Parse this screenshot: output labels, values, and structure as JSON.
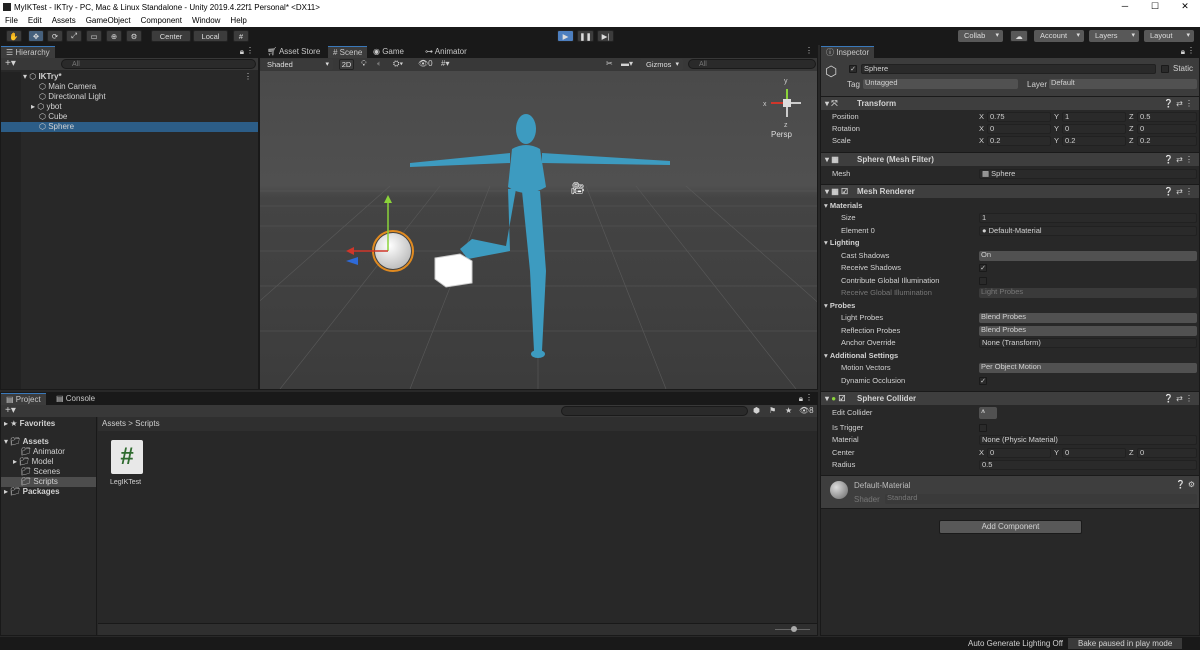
{
  "window": {
    "title": "MyIKTest - IKTry - PC, Mac & Linux Standalone - Unity 2019.4.22f1 Personal* <DX11>",
    "minimize": "─",
    "maximize": "☐",
    "close": "✕"
  },
  "menu": [
    "File",
    "Edit",
    "Assets",
    "GameObject",
    "Component",
    "Window",
    "Help"
  ],
  "toolbar": {
    "center": "Center",
    "local": "Local",
    "collab": "Collab",
    "account": "Account",
    "layers": "Layers",
    "layout": "Layout"
  },
  "hierarchy": {
    "tab": "Hierarchy",
    "search": "All",
    "scene": "IKTry*",
    "items": [
      "Main Camera",
      "Directional Light",
      "ybot",
      "Cube",
      "Sphere"
    ]
  },
  "sceneView": {
    "tabs": [
      "Asset Store",
      "Scene",
      "Game",
      "Animator"
    ],
    "shading": "Shaded",
    "mode2d": "2D",
    "gizmos": "Gizmos",
    "search": "All",
    "hidden": "0",
    "persp": "Persp",
    "axisX": "x",
    "axisY": "y",
    "axisZ": "z"
  },
  "project": {
    "tabs": [
      "Project",
      "Console"
    ],
    "favorites": "Favorites",
    "assets": "Assets",
    "folders": [
      "Animator",
      "Model",
      "Scenes",
      "Scripts"
    ],
    "packages": "Packages",
    "breadcrumb": [
      "Assets",
      "Scripts"
    ],
    "file": "LegIKTest",
    "fileIcon": "#",
    "count": "8"
  },
  "status": {
    "lighting": "Auto Generate Lighting Off",
    "bake": "Bake paused in play mode"
  },
  "inspector": {
    "tab": "Inspector",
    "name": "Sphere",
    "static": "Static",
    "tagLabel": "Tag",
    "tag": "Untagged",
    "layerLabel": "Layer",
    "layer": "Default",
    "transform": {
      "title": "Transform",
      "rows": [
        {
          "label": "Position",
          "x": "0.75",
          "y": "1",
          "z": "0.5"
        },
        {
          "label": "Rotation",
          "x": "0",
          "y": "0",
          "z": "0"
        },
        {
          "label": "Scale",
          "x": "0.2",
          "y": "0.2",
          "z": "0.2"
        }
      ]
    },
    "meshFilter": {
      "title": "Sphere (Mesh Filter)",
      "meshLabel": "Mesh",
      "mesh": "Sphere"
    },
    "meshRenderer": {
      "title": "Mesh Renderer",
      "materials": "Materials",
      "sizeLabel": "Size",
      "size": "1",
      "elementLabel": "Element 0",
      "element": "Default-Material",
      "lighting": "Lighting",
      "castLabel": "Cast Shadows",
      "cast": "On",
      "receiveLabel": "Receive Shadows",
      "contribLabel": "Contribute Global Illumination",
      "receiveGILabel": "Receive Global Illumination",
      "receiveGI": "Light Probes",
      "probes": "Probes",
      "lightProbesLabel": "Light Probes",
      "lightProbes": "Blend Probes",
      "reflLabel": "Reflection Probes",
      "refl": "Blend Probes",
      "anchorLabel": "Anchor Override",
      "anchor": "None (Transform)",
      "additional": "Additional Settings",
      "motionLabel": "Motion Vectors",
      "motion": "Per Object Motion",
      "dynLabel": "Dynamic Occlusion"
    },
    "collider": {
      "title": "Sphere Collider",
      "editLabel": "Edit Collider",
      "triggerLabel": "Is Trigger",
      "materialLabel": "Material",
      "material": "None (Physic Material)",
      "centerLabel": "Center",
      "cx": "0",
      "cy": "0",
      "cz": "0",
      "radiusLabel": "Radius",
      "radius": "0.5"
    },
    "material": {
      "name": "Default-Material",
      "shaderLabel": "Shader",
      "shader": "Standard"
    },
    "addComponent": "Add Component",
    "axisLabels": {
      "x": "X",
      "y": "Y",
      "z": "Z"
    }
  }
}
